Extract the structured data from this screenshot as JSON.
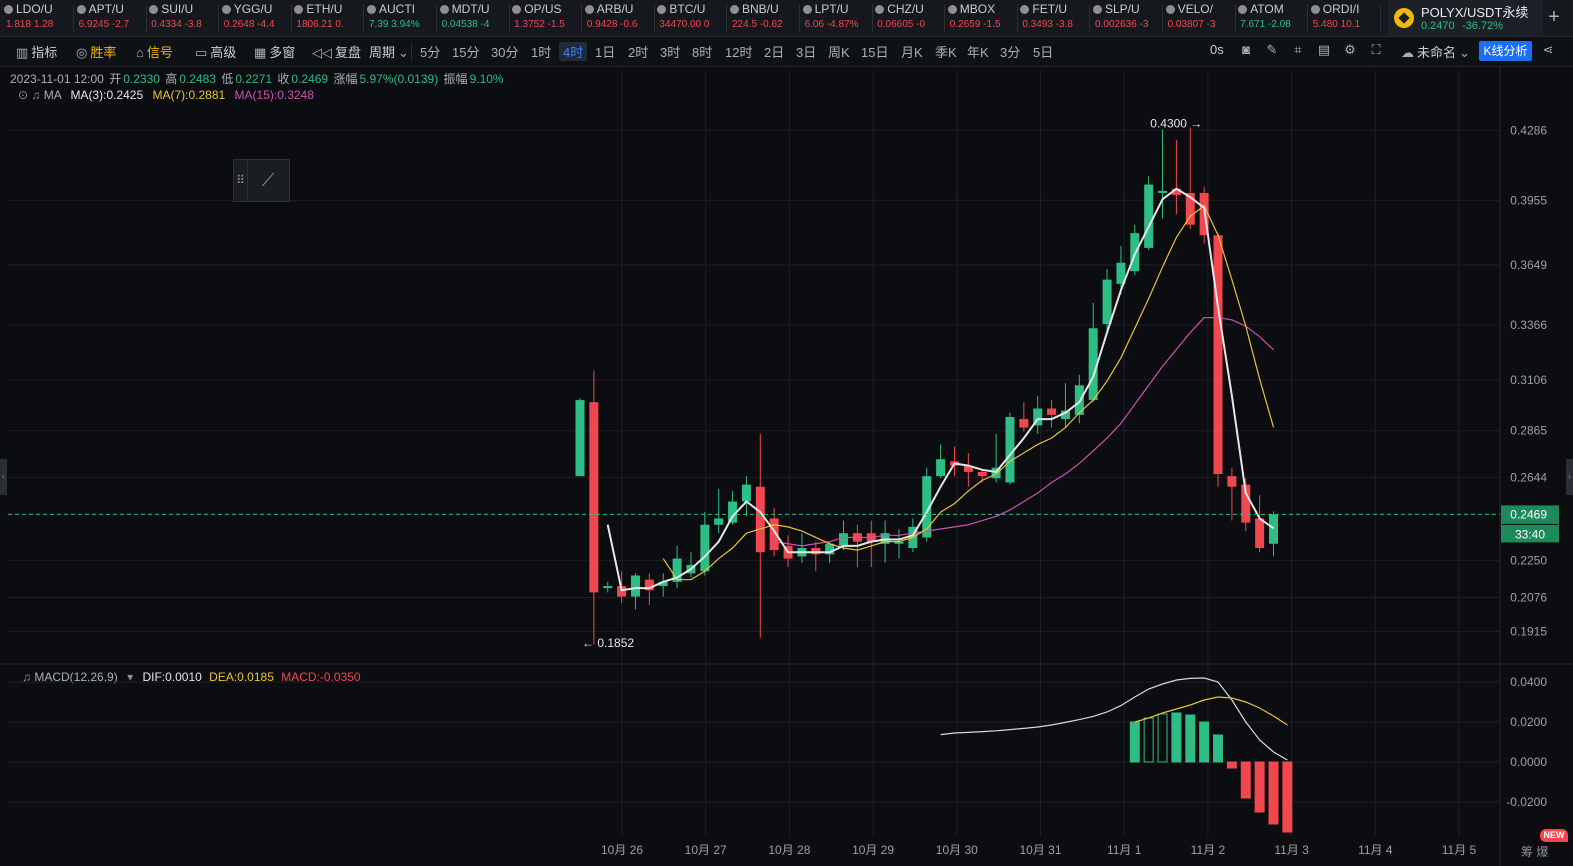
{
  "tickers": [
    {
      "name": "LDO/U",
      "price": "1.818",
      "change": "1.28",
      "dir": "dn"
    },
    {
      "name": "APT/U",
      "price": "6.9245",
      "change": "-2.7",
      "dir": "dn"
    },
    {
      "name": "SUI/U",
      "price": "0.4334",
      "change": "-3.8",
      "dir": "dn"
    },
    {
      "name": "YGG/U",
      "price": "0.2648",
      "change": "-4.4",
      "dir": "dn"
    },
    {
      "name": "ETH/U",
      "price": "1806.21",
      "change": "0.",
      "dir": "dn"
    },
    {
      "name": "AUCTI",
      "price": "7.39",
      "change": "3.94%",
      "dir": "up"
    },
    {
      "name": "MDT/U",
      "price": "0.04538",
      "change": "-4",
      "dir": "up"
    },
    {
      "name": "OP/US",
      "price": "1.3752",
      "change": "-1.5",
      "dir": "dn"
    },
    {
      "name": "ARB/U",
      "price": "0.9428",
      "change": "-0.6",
      "dir": "dn"
    },
    {
      "name": "BTC/U",
      "price": "34470.00",
      "change": "0",
      "dir": "dn"
    },
    {
      "name": "BNB/U",
      "price": "224.5",
      "change": "-0.62",
      "dir": "dn"
    },
    {
      "name": "LPT/U",
      "price": "6.06",
      "change": "-4.87%",
      "dir": "dn"
    },
    {
      "name": "CHZ/U",
      "price": "0.06605",
      "change": "-0",
      "dir": "dn"
    },
    {
      "name": "MBOX",
      "price": "0.2659",
      "change": "-1.5",
      "dir": "dn"
    },
    {
      "name": "FET/U",
      "price": "0.3493",
      "change": "-3.8",
      "dir": "dn"
    },
    {
      "name": "SLP/U",
      "price": "0.002636",
      "change": "-3",
      "dir": "dn"
    },
    {
      "name": "VELO/",
      "price": "0.03807",
      "change": "-3",
      "dir": "dn"
    },
    {
      "name": "ATOM",
      "price": "7.671",
      "change": "-2.08",
      "dir": "up"
    },
    {
      "name": "ORDI/I",
      "price": "5.480",
      "change": "10.1",
      "dir": "dn"
    }
  ],
  "current_symbol": {
    "name": "POLYX/USDT永续",
    "price": "0.2470",
    "change": "-36.72%"
  },
  "add_tab": "+",
  "toolbar": {
    "indicator": "指标",
    "winrate": "胜率",
    "signal": "信号",
    "advanced": "高级",
    "multiwin": "多窗",
    "replay": "复盘",
    "period": "周期",
    "intervals": [
      "5分",
      "15分",
      "30分",
      "1时",
      "4时",
      "1日",
      "2时",
      "3时",
      "8时",
      "12时",
      "2日",
      "3日",
      "周K",
      "15日",
      "月K",
      "季K",
      "年K",
      "3分",
      "5日"
    ],
    "active_interval": "4时",
    "countdown": "0s",
    "unnamed": "未命名",
    "kline_analysis": "K线分析"
  },
  "ohlc": {
    "date": "2023-11-01 12:00",
    "open_label": "开",
    "open": "0.2330",
    "high_label": "高",
    "high": "0.2483",
    "low_label": "低",
    "low": "0.2271",
    "close_label": "收",
    "close": "0.2469",
    "chg_label": "涨幅",
    "chg": "5.97%(0.0139)",
    "amp_label": "振幅",
    "amp": "9.10%"
  },
  "ma_legend": {
    "label": "MA",
    "ma3": "MA(3):0.2425",
    "ma7": "MA(7):0.2881",
    "ma15": "MA(15):0.3248"
  },
  "macd_legend": {
    "label": "MACD(12,26,9)",
    "dif": "DIF:0.0010",
    "dea": "DEA:0.0185",
    "macd": "MACD:-0.0350"
  },
  "bottom": {
    "new_badge": "NEW",
    "icons": "筹 爆"
  },
  "colors": {
    "up": "#2ebd85",
    "down": "#f0484e",
    "ma3": "#e6e6e6",
    "ma7": "#e8c23a",
    "ma15": "#d14fb2",
    "dif": "#d9d9d9",
    "dea": "#e8c23a",
    "accent": "#1e6ff0"
  },
  "chart_data": [
    {
      "type": "candlestick",
      "title": "POLYX/USDT 4H",
      "x_labels": [
        "10月 26",
        "10月 27",
        "10月 28",
        "10月 29",
        "10月 30",
        "10月 31",
        "11月 1",
        "11月 2",
        "11月 3",
        "11月 4",
        "11月 5"
      ],
      "y_ticks": [
        "0.4286",
        "0.3955",
        "0.3649",
        "0.3366",
        "0.3106",
        "0.2865",
        "0.2644",
        "0.2250",
        "0.2076",
        "0.1915"
      ],
      "y_range": [
        0.178,
        0.443
      ],
      "current_price": "0.2469",
      "countdown": "33:40",
      "high_marker": "0.4300",
      "low_marker": "0.1852",
      "candles": [
        [
          0.265,
          0.301,
          0.265,
          0.302
        ],
        [
          0.3,
          0.21,
          0.1852,
          0.315
        ],
        [
          0.212,
          0.213,
          0.21,
          0.215
        ],
        [
          0.213,
          0.208,
          0.205,
          0.22
        ],
        [
          0.208,
          0.218,
          0.202,
          0.219
        ],
        [
          0.216,
          0.211,
          0.204,
          0.219
        ],
        [
          0.213,
          0.215,
          0.208,
          0.219
        ],
        [
          0.215,
          0.226,
          0.212,
          0.232
        ],
        [
          0.219,
          0.223,
          0.217,
          0.229
        ],
        [
          0.22,
          0.242,
          0.218,
          0.248
        ],
        [
          0.242,
          0.245,
          0.238,
          0.259
        ],
        [
          0.243,
          0.253,
          0.242,
          0.258
        ],
        [
          0.253,
          0.261,
          0.246,
          0.265
        ],
        [
          0.26,
          0.229,
          0.1885,
          0.285
        ],
        [
          0.245,
          0.23,
          0.227,
          0.25
        ],
        [
          0.232,
          0.226,
          0.222,
          0.237
        ],
        [
          0.227,
          0.231,
          0.224,
          0.238
        ],
        [
          0.231,
          0.228,
          0.22,
          0.234
        ],
        [
          0.228,
          0.233,
          0.224,
          0.234
        ],
        [
          0.232,
          0.238,
          0.23,
          0.244
        ],
        [
          0.238,
          0.234,
          0.222,
          0.242
        ],
        [
          0.238,
          0.234,
          0.222,
          0.244
        ],
        [
          0.233,
          0.238,
          0.224,
          0.244
        ],
        [
          0.233,
          0.234,
          0.226,
          0.24
        ],
        [
          0.231,
          0.241,
          0.229,
          0.245
        ],
        [
          0.236,
          0.265,
          0.234,
          0.269
        ],
        [
          0.265,
          0.273,
          0.264,
          0.28
        ],
        [
          0.272,
          0.27,
          0.265,
          0.279
        ],
        [
          0.27,
          0.267,
          0.26,
          0.276
        ],
        [
          0.267,
          0.265,
          0.262,
          0.268
        ],
        [
          0.264,
          0.269,
          0.262,
          0.285
        ],
        [
          0.262,
          0.293,
          0.261,
          0.295
        ],
        [
          0.292,
          0.288,
          0.286,
          0.3
        ],
        [
          0.289,
          0.297,
          0.285,
          0.303
        ],
        [
          0.297,
          0.294,
          0.288,
          0.301
        ],
        [
          0.292,
          0.296,
          0.288,
          0.309
        ],
        [
          0.294,
          0.308,
          0.29,
          0.313
        ],
        [
          0.301,
          0.335,
          0.3,
          0.347
        ],
        [
          0.337,
          0.358,
          0.334,
          0.363
        ],
        [
          0.356,
          0.366,
          0.351,
          0.374
        ],
        [
          0.362,
          0.38,
          0.36,
          0.384
        ],
        [
          0.373,
          0.403,
          0.372,
          0.407
        ],
        [
          0.399,
          0.4,
          0.387,
          0.429
        ],
        [
          0.401,
          0.398,
          0.389,
          0.424
        ],
        [
          0.399,
          0.384,
          0.382,
          0.43
        ],
        [
          0.399,
          0.379,
          0.375,
          0.402
        ],
        [
          0.379,
          0.266,
          0.26,
          0.38
        ],
        [
          0.265,
          0.26,
          0.244,
          0.269
        ],
        [
          0.261,
          0.243,
          0.239,
          0.264
        ],
        [
          0.245,
          0.231,
          0.229,
          0.256
        ],
        [
          0.233,
          0.2469,
          0.2271,
          0.2483
        ]
      ],
      "ma3": [
        null,
        null,
        0.242,
        0.211,
        0.212,
        0.212,
        0.215,
        0.217,
        0.221,
        0.227,
        0.234,
        0.246,
        0.253,
        0.248,
        0.239,
        0.229,
        0.229,
        0.229,
        0.229,
        0.232,
        0.232,
        0.234,
        0.235,
        0.235,
        0.237,
        0.248,
        0.26,
        0.271,
        0.27,
        0.268,
        0.267,
        0.275,
        0.283,
        0.292,
        0.292,
        0.295,
        0.3,
        0.312,
        0.333,
        0.353,
        0.37,
        0.383,
        0.396,
        0.401,
        0.397,
        0.392,
        0.345,
        0.303,
        0.257,
        0.245,
        0.2403
      ],
      "ma7": [
        null,
        null,
        null,
        null,
        null,
        null,
        0.226,
        0.216,
        0.216,
        0.22,
        0.226,
        0.231,
        0.238,
        0.24,
        0.242,
        0.241,
        0.239,
        0.236,
        0.233,
        0.231,
        0.23,
        0.232,
        0.234,
        0.234,
        0.236,
        0.24,
        0.248,
        0.252,
        0.258,
        0.263,
        0.266,
        0.272,
        0.276,
        0.28,
        0.283,
        0.288,
        0.295,
        0.301,
        0.31,
        0.321,
        0.335,
        0.349,
        0.364,
        0.378,
        0.388,
        0.393,
        0.379,
        0.358,
        0.336,
        0.311,
        0.2881
      ],
      "ma15": [
        null,
        null,
        null,
        null,
        null,
        null,
        null,
        null,
        null,
        null,
        null,
        null,
        null,
        null,
        0.234,
        0.233,
        0.232,
        0.233,
        0.234,
        0.236,
        0.236,
        0.236,
        0.237,
        0.237,
        0.238,
        0.239,
        0.24,
        0.241,
        0.242,
        0.244,
        0.246,
        0.249,
        0.253,
        0.257,
        0.262,
        0.266,
        0.271,
        0.277,
        0.283,
        0.29,
        0.299,
        0.308,
        0.317,
        0.325,
        0.333,
        0.34,
        0.34,
        0.339,
        0.336,
        0.331,
        0.3248
      ]
    },
    {
      "type": "macd",
      "title": "MACD(12,26,9)",
      "y_ticks": [
        "0.0400",
        "0.0200",
        "0.0000",
        "-0.0200"
      ],
      "y_range": [
        -0.037,
        0.047
      ],
      "start_index": 26,
      "dif": [
        0.0137,
        0.0145,
        0.0148,
        0.0152,
        0.0156,
        0.0162,
        0.0168,
        0.0175,
        0.0185,
        0.0198,
        0.0212,
        0.0228,
        0.025,
        0.0282,
        0.0325,
        0.0365,
        0.039,
        0.041,
        0.0418,
        0.042,
        0.04,
        0.031,
        0.02,
        0.011,
        0.005,
        0.001
      ],
      "dea": [
        null,
        null,
        null,
        null,
        null,
        null,
        null,
        null,
        null,
        null,
        null,
        null,
        null,
        null,
        0.02,
        0.022,
        0.0245,
        0.0265,
        0.0285,
        0.031,
        0.0325,
        0.032,
        0.03,
        0.027,
        0.023,
        0.0185
      ],
      "hist": [
        null,
        null,
        null,
        null,
        null,
        null,
        null,
        null,
        null,
        null,
        null,
        null,
        null,
        null,
        0.02,
        0.022,
        0.024,
        0.0245,
        0.0235,
        0.02,
        0.0135,
        -0.003,
        -0.018,
        -0.025,
        -0.031,
        -0.035
      ],
      "hist_hollow": [
        false,
        false,
        false,
        false,
        false,
        false,
        false,
        false,
        false,
        false,
        false,
        false,
        false,
        false,
        false,
        true,
        true,
        false,
        false,
        false,
        false,
        false,
        false,
        false,
        false,
        false
      ]
    }
  ]
}
